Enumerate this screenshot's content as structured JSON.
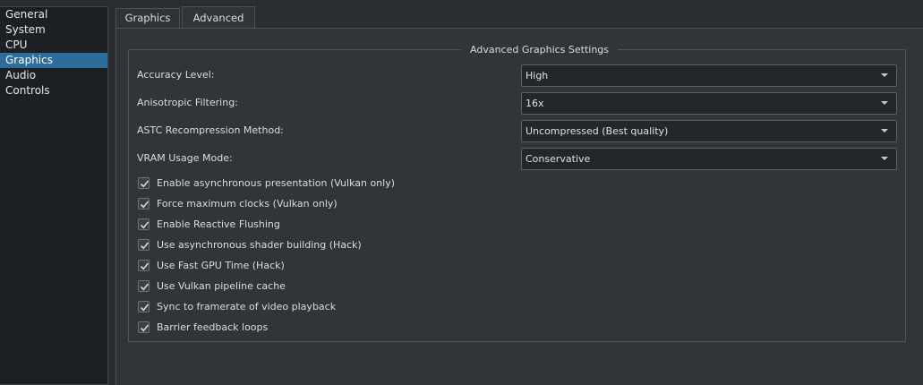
{
  "sidebar": {
    "items": [
      {
        "label": "General"
      },
      {
        "label": "System"
      },
      {
        "label": "CPU"
      },
      {
        "label": "Graphics",
        "selected": true
      },
      {
        "label": "Audio"
      },
      {
        "label": "Controls"
      }
    ]
  },
  "tabs": [
    {
      "label": "Graphics",
      "active": false
    },
    {
      "label": "Advanced",
      "active": true
    }
  ],
  "group": {
    "title": "Advanced Graphics Settings",
    "settings": [
      {
        "label": "Accuracy Level:",
        "value": "High"
      },
      {
        "label": "Anisotropic Filtering:",
        "value": "16x"
      },
      {
        "label": "ASTC Recompression Method:",
        "value": "Uncompressed (Best quality)"
      },
      {
        "label": "VRAM Usage Mode:",
        "value": "Conservative"
      }
    ],
    "checkboxes": [
      {
        "label": "Enable asynchronous presentation (Vulkan only)",
        "checked": true
      },
      {
        "label": "Force maximum clocks (Vulkan only)",
        "checked": true
      },
      {
        "label": "Enable Reactive Flushing",
        "checked": true
      },
      {
        "label": "Use asynchronous shader building (Hack)",
        "checked": true
      },
      {
        "label": "Use Fast GPU Time (Hack)",
        "checked": true
      },
      {
        "label": "Use Vulkan pipeline cache",
        "checked": true
      },
      {
        "label": "Sync to framerate of video playback",
        "checked": true
      },
      {
        "label": "Barrier feedback loops",
        "checked": true
      }
    ]
  },
  "colors": {
    "selection": "#2d6d9b",
    "background": "#313539",
    "sidebar_background": "#1d2023"
  }
}
